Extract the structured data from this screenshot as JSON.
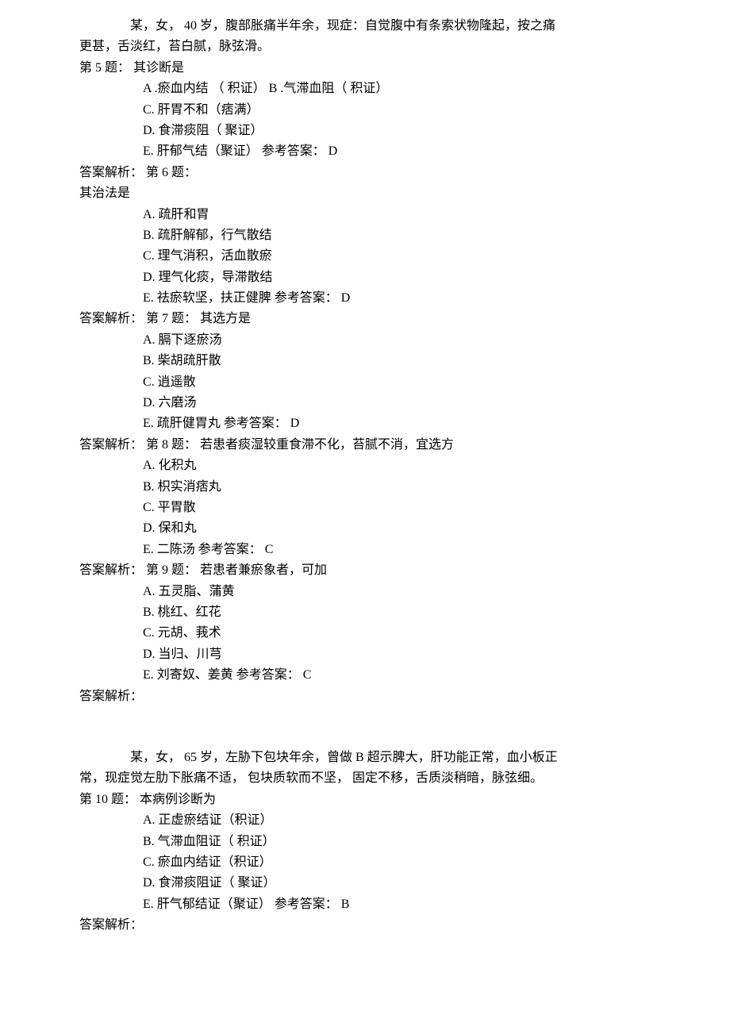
{
  "case1": {
    "intro_line1": "某，女，  40 岁，腹部胀痛半年余，现症：自觉腹中有条索状物隆起，按之痛",
    "intro_line2": "更甚，舌淡红，苔白腻，脉弦滑。",
    "q5": {
      "header": "第 5 题：  其诊断是",
      "a": "A .瘀血内结 （ 积证） B .气滞血阻（ 积证）",
      "c": "C. 肝胃不和（痞满）",
      "d": "D. 食滞痰阻（ 聚证）",
      "e": "E.   肝郁气结（聚证） 参考答案：  D"
    },
    "q6": {
      "analysis_header": "答案解析：  第 6 题：",
      "sub_header": "其治法是",
      "a": "A. 疏肝和胃",
      "b": "B. 疏肝解郁，行气散结",
      "c": "C. 理气消积，活血散瘀",
      "d": "D. 理气化痰，导滞散结",
      "e": "E.   祛瘀软坚，扶正健脾 参考答案：  D"
    },
    "q7": {
      "analysis_header": "答案解析：  第 7 题：  其选方是",
      "a": "A. 膈下逐瘀汤",
      "b": "B. 柴胡疏肝散",
      "c": "C. 逍遥散",
      "d": "D. 六磨汤",
      "e": "E.   疏肝健胃丸 参考答案：  D"
    },
    "q8": {
      "analysis_header": "答案解析：  第 8 题：  若患者痰湿较重食滞不化，苔腻不消，宜选方",
      "a": "A. 化积丸",
      "b": "B. 枳实消痞丸",
      "c": "C. 平胃散",
      "d": "D. 保和丸",
      "e": "E.   二陈汤 参考答案：  C"
    },
    "q9": {
      "analysis_header": "答案解析：  第 9 题：  若患者兼瘀象者，可加",
      "a": "A. 五灵脂、蒲黄",
      "b": "B. 桃红、红花",
      "c": "C. 元胡、莪术",
      "d": "D. 当归、川芎",
      "e": "E.   刘寄奴、姜黄 参考答案：  C",
      "final": "答案解析："
    }
  },
  "case2": {
    "intro_line1": "某，女，  65 岁，左胁下包块年余，曾做 B 超示脾大，肝功能正常，血小板正",
    "intro_line2": "常，现症觉左肋下胀痛不适，  包块质软而不坚，  固定不移，舌质淡稍暗，脉弦细。",
    "q10": {
      "header": "第 10 题：  本病例诊断为",
      "a": "A. 正虚瘀结证（积证）",
      "b": "B. 气滞血阻证（ 积证）",
      "c": "C. 瘀血内结证（积证）",
      "d": "D. 食滞痰阻证（ 聚证）",
      "e": "E.   肝气郁结证（聚证） 参考答案：  B",
      "final": "答案解析："
    }
  }
}
